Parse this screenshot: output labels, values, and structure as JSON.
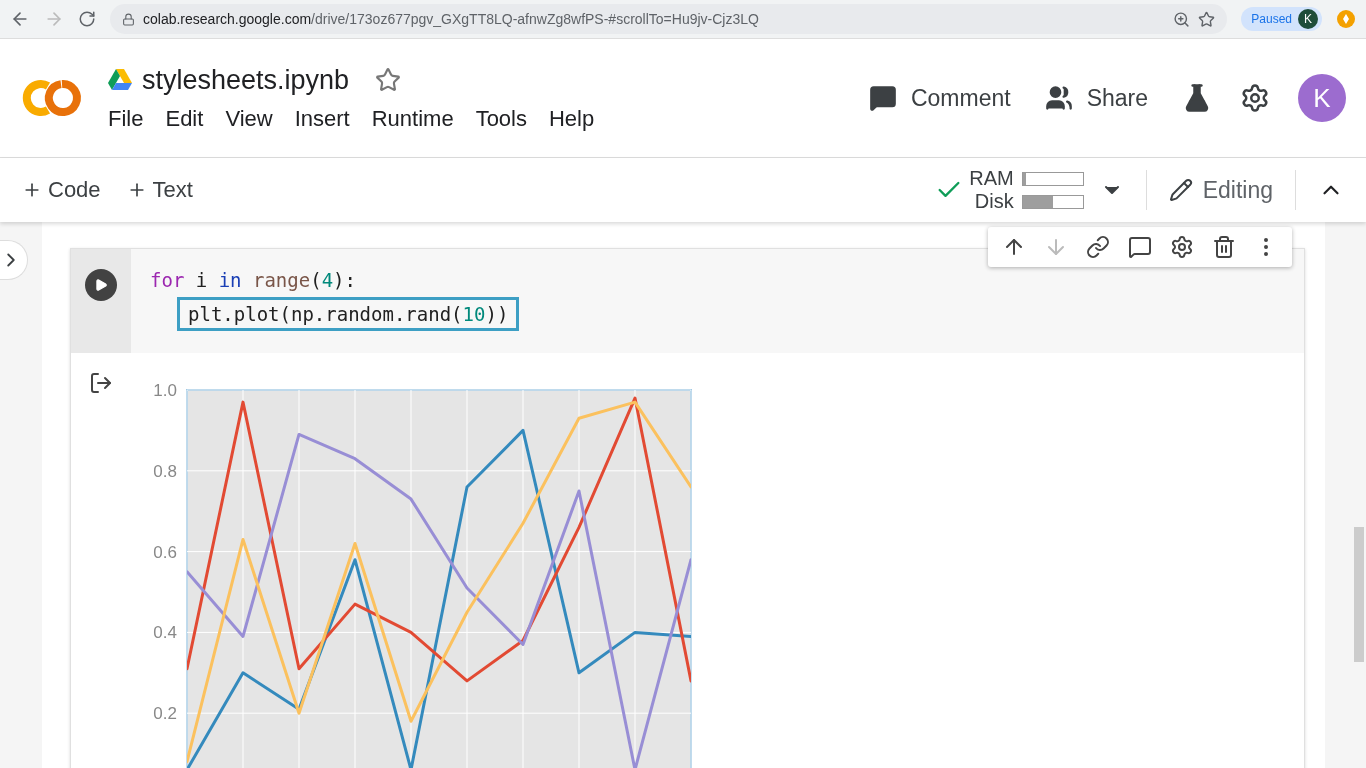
{
  "browser": {
    "url_host": "colab.research.google.com",
    "url_path": "/drive/173oz677pgv_GXgTT8LQ-afnwZg8wfPS-#scrollTo=Hu9jv-Cjz3LQ",
    "paused_label": "Paused",
    "profile_initial": "K"
  },
  "notebook": {
    "title": "stylesheets.ipynb",
    "starred": false,
    "menu": [
      "File",
      "Edit",
      "View",
      "Insert",
      "Runtime",
      "Tools",
      "Help"
    ]
  },
  "header_actions": [
    {
      "kind": "comment",
      "label": "Comment"
    },
    {
      "kind": "share",
      "label": "Share"
    }
  ],
  "avatar_initial": "K",
  "toolbar": {
    "add_buttons": [
      "Code",
      "Text"
    ],
    "connected": true,
    "resources": [
      {
        "label": "RAM",
        "level": 0.05
      },
      {
        "label": "Disk",
        "level": 0.5
      }
    ],
    "mode": "Editing"
  },
  "cell": {
    "actions": [
      {
        "kind": "up",
        "disabled": false
      },
      {
        "kind": "down",
        "disabled": true
      },
      {
        "kind": "link",
        "disabled": false
      },
      {
        "kind": "comment",
        "disabled": false
      },
      {
        "kind": "settings",
        "disabled": false
      },
      {
        "kind": "delete",
        "disabled": false
      },
      {
        "kind": "more",
        "disabled": false
      }
    ],
    "code_lines": [
      {
        "highlighted": false,
        "indent": false,
        "tokens": [
          {
            "kind": "keyword",
            "text": "for"
          },
          {
            "kind": "plain",
            "text": " i "
          },
          {
            "kind": "operator",
            "text": "in "
          },
          {
            "kind": "builtin",
            "text": "range"
          },
          {
            "kind": "plain",
            "text": "("
          },
          {
            "kind": "number",
            "text": "4"
          },
          {
            "kind": "plain",
            "text": "):"
          }
        ]
      },
      {
        "highlighted": true,
        "indent": true,
        "tokens": [
          {
            "kind": "plain",
            "text": "plt.plot(np.random.rand("
          },
          {
            "kind": "number",
            "text": "10"
          },
          {
            "kind": "plain",
            "text": "))"
          }
        ]
      }
    ],
    "output": {
      "chart_data": {
        "type": "line",
        "grid": true,
        "ylim": [
          0.05,
          1.0
        ],
        "yticks": [
          {
            "value": 0.2,
            "label": "0.2"
          },
          {
            "value": 0.4,
            "label": "0.4"
          },
          {
            "value": 0.6,
            "label": "0.6"
          },
          {
            "value": 0.8,
            "label": "0.8"
          },
          {
            "value": 1.0,
            "label": "1.0"
          }
        ],
        "series": [
          {
            "color": "#348abd",
            "values": [
              0.06,
              0.3,
              0.21,
              0.58,
              0.06,
              0.76,
              0.9,
              0.3,
              0.4,
              0.39
            ]
          },
          {
            "color": "#e24a33",
            "values": [
              0.31,
              0.97,
              0.31,
              0.47,
              0.4,
              0.28,
              0.38,
              0.66,
              0.98,
              0.28
            ]
          },
          {
            "color": "#988ed5",
            "values": [
              0.55,
              0.39,
              0.89,
              0.83,
              0.73,
              0.51,
              0.37,
              0.75,
              0.06,
              0.58
            ]
          },
          {
            "color": "#fbc15e",
            "values": [
              0.08,
              0.63,
              0.2,
              0.62,
              0.18,
              0.45,
              0.67,
              0.93,
              0.97,
              0.76
            ]
          }
        ]
      }
    }
  }
}
